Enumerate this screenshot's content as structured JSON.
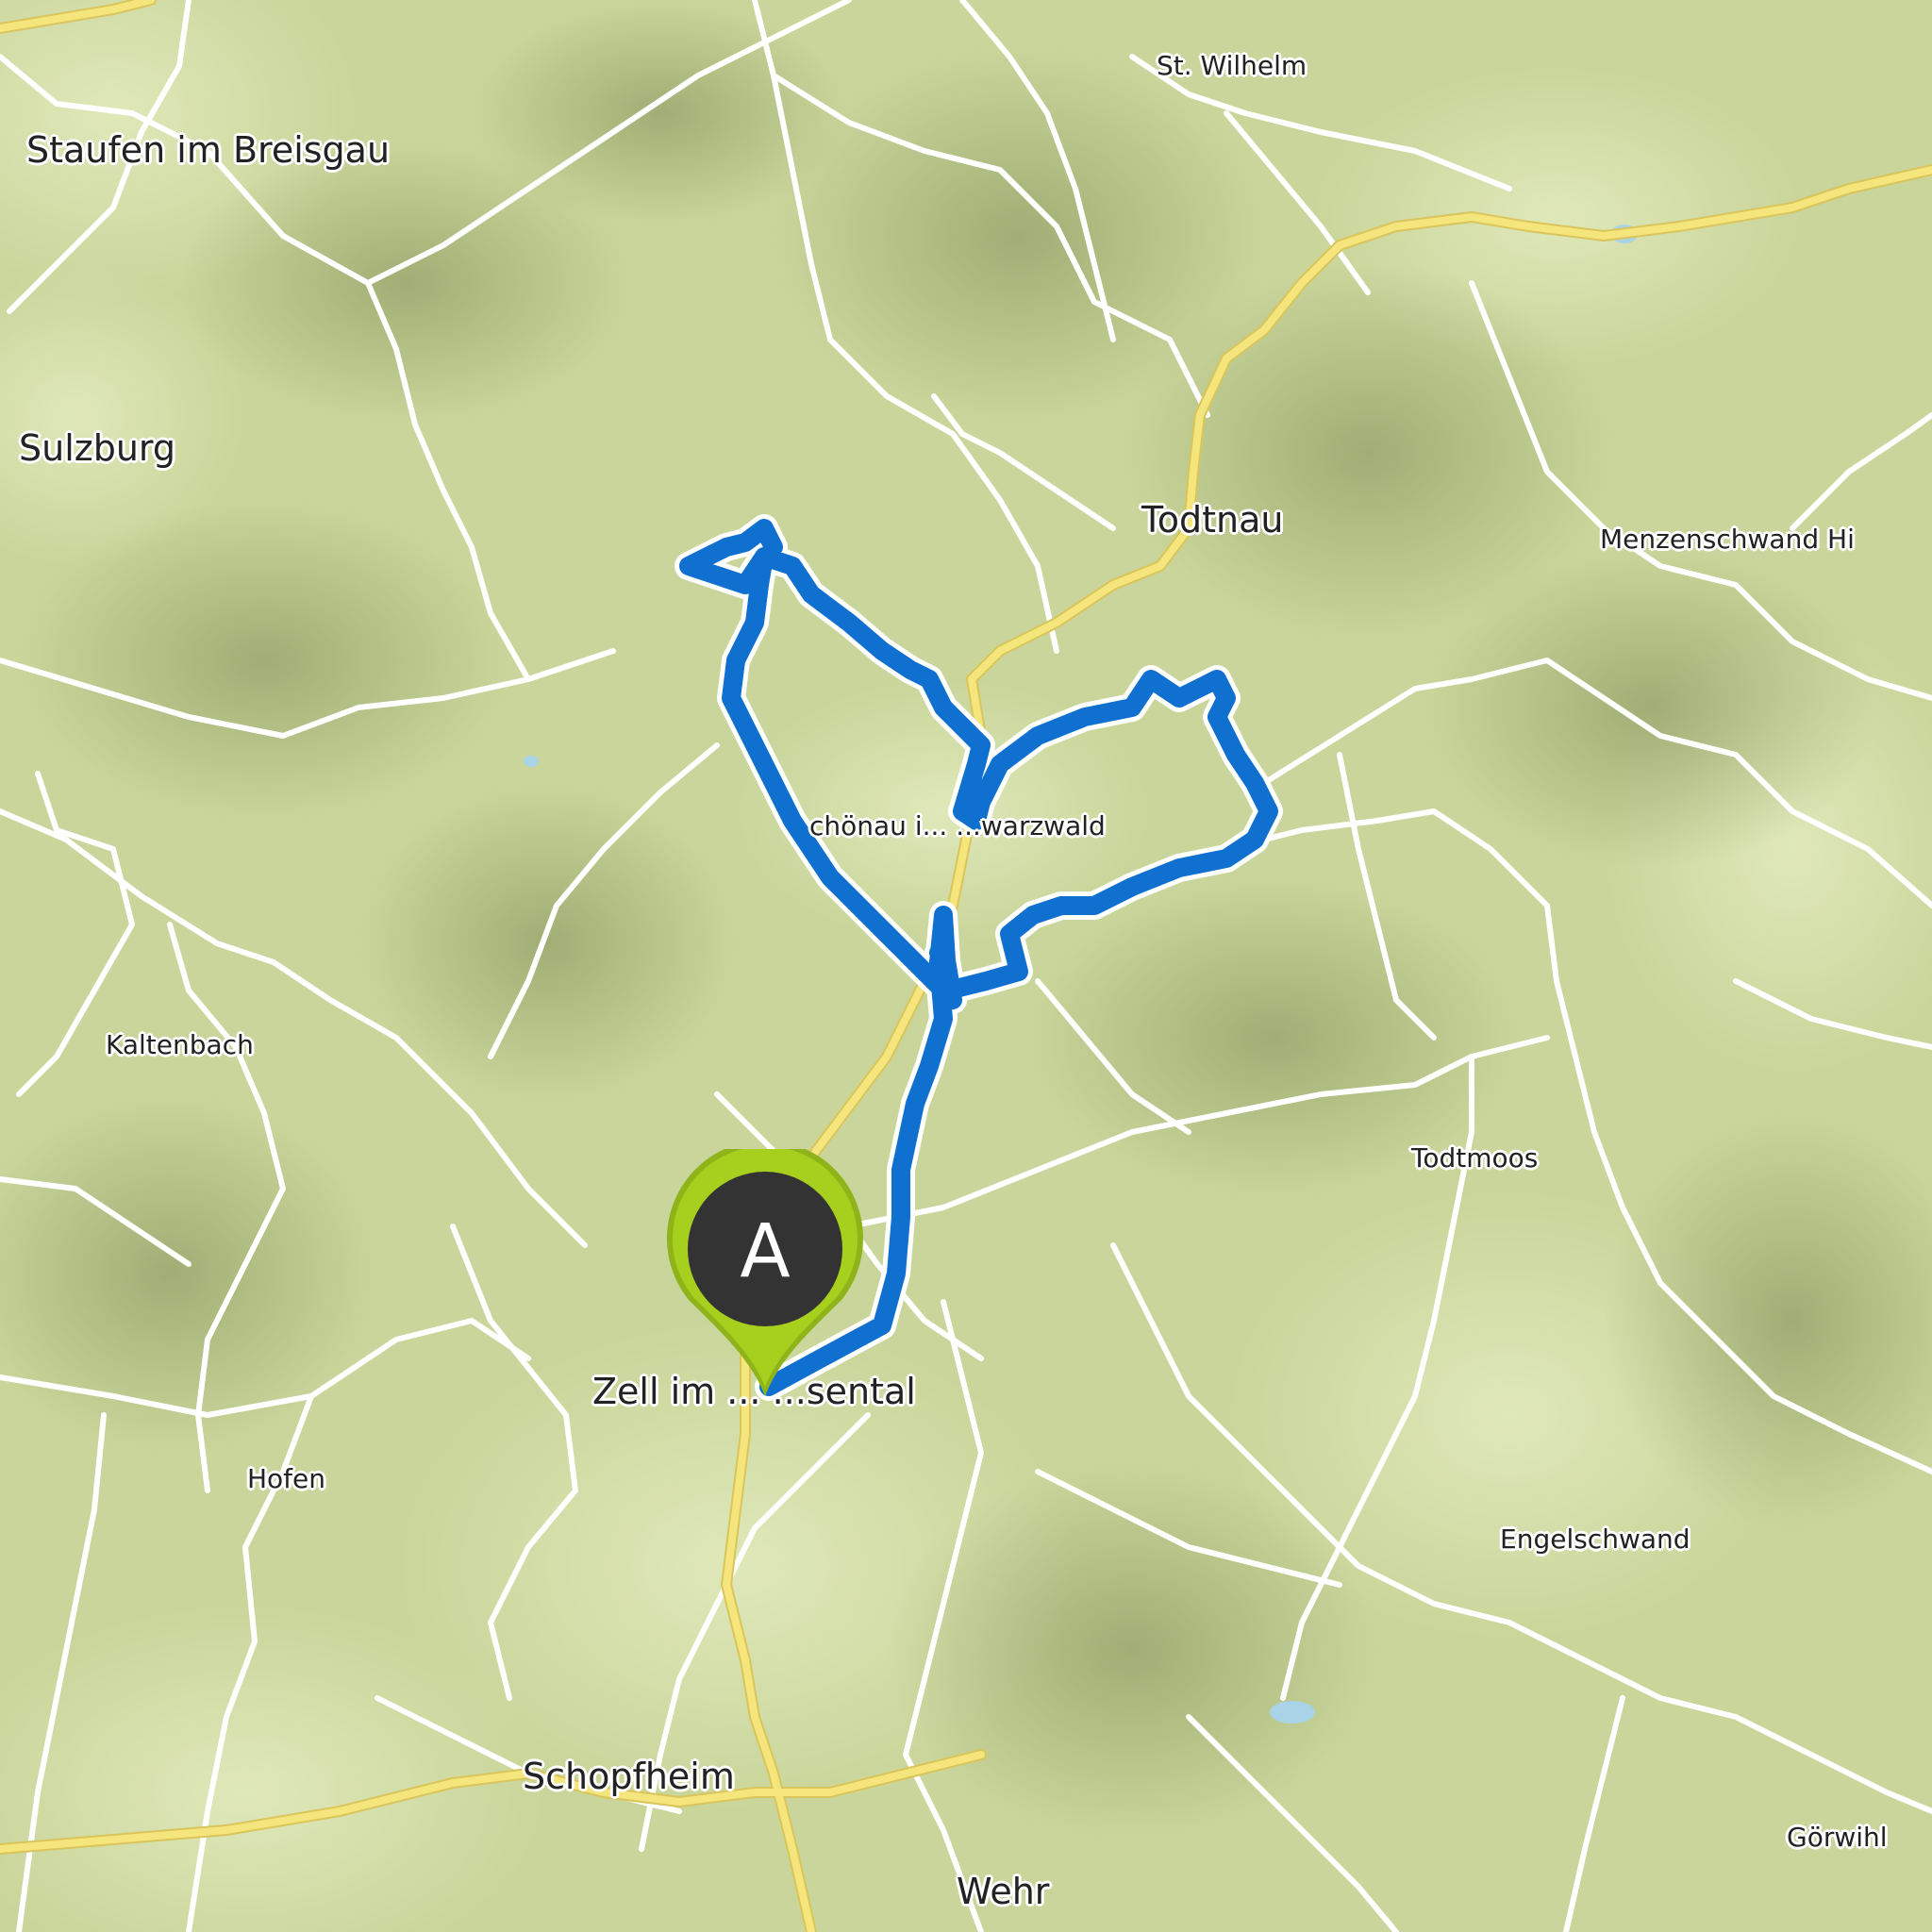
{
  "map": {
    "colors": {
      "terrain": "#c9d59a",
      "terrain_light": "#dde6b4",
      "hillshade": "#8f9c66",
      "road": "#ffffff",
      "main_road": "#f2e27a",
      "water": "#a9d3e6",
      "route": "#1070d0",
      "marker": "#a6cf1e",
      "marker_inner": "#333333"
    },
    "places": [
      {
        "id": "staufen",
        "name": "Staufen im Breisgau"
      },
      {
        "id": "st-wilhelm",
        "name": "St. Wilhelm"
      },
      {
        "id": "sulzburg",
        "name": "Sulzburg"
      },
      {
        "id": "todtnau",
        "name": "Todtnau"
      },
      {
        "id": "menzenschwand",
        "name": "Menzenschwand Hi"
      },
      {
        "id": "schoenau",
        "name": "chönau i... ...warzwald"
      },
      {
        "id": "kaltenbach",
        "name": "Kaltenbach"
      },
      {
        "id": "todtmoos",
        "name": "Todtmoos"
      },
      {
        "id": "zell",
        "name": "Zell im ... ...sental"
      },
      {
        "id": "hofen",
        "name": "Hofen"
      },
      {
        "id": "engelschwand",
        "name": "Engelschwand"
      },
      {
        "id": "schopfheim",
        "name": "Schopfheim"
      },
      {
        "id": "goerwihl",
        "name": "Görwihl"
      },
      {
        "id": "wehr",
        "name": "Wehr"
      }
    ],
    "route": {
      "start_marker_label": "A"
    }
  }
}
